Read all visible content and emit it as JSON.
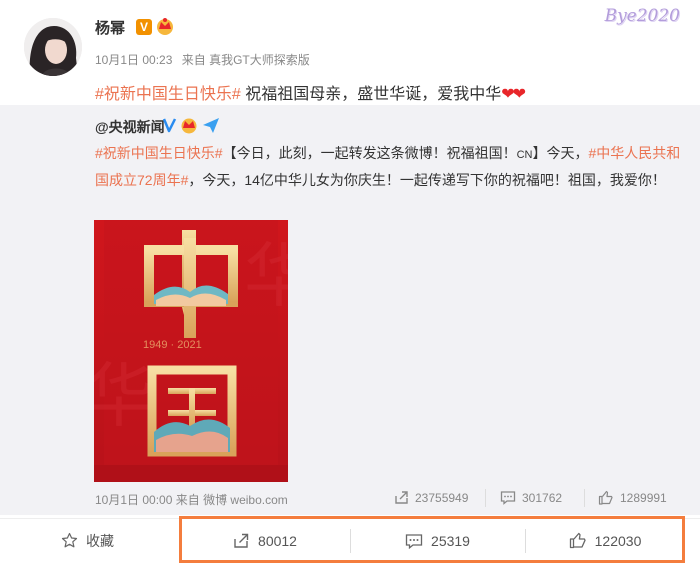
{
  "post": {
    "author": "杨幂",
    "time": "10月1日 00:23",
    "source": "来自 真我GT大师探索版",
    "hashtag": "#祝新中国生日快乐#",
    "text": " 祝福祖国母亲，盛世华诞，爱我中华",
    "hearts": "❤❤"
  },
  "watermark": "Bye2020",
  "repost": {
    "author": "@央视新闻",
    "tag1": "#祝新中国生日快乐#",
    "text1": "【今日，此刻，一起转发这条微博！祝福祖国！",
    "cn": "CN",
    "text2": "】今天，",
    "tag2": "#中华人民共和国成立72周年#",
    "text3": "，今天，14亿中华儿女为你庆生！一起传递写下你的祝福吧！祖国，我爱你！",
    "poster_years": "1949 · 2021",
    "poster_chars": [
      "中",
      "国"
    ],
    "time": "10月1日 00:00",
    "source": "来自 微博 weibo.com",
    "reposts": "23755949",
    "comments": "301762",
    "likes": "1289991"
  },
  "actions": {
    "favorite": "收藏",
    "reposts": "80012",
    "comments": "25319",
    "likes": "122030"
  },
  "colors": {
    "tag": "#eb7350",
    "highlight": "#f47d3d",
    "poster_red": "#c8161d"
  }
}
